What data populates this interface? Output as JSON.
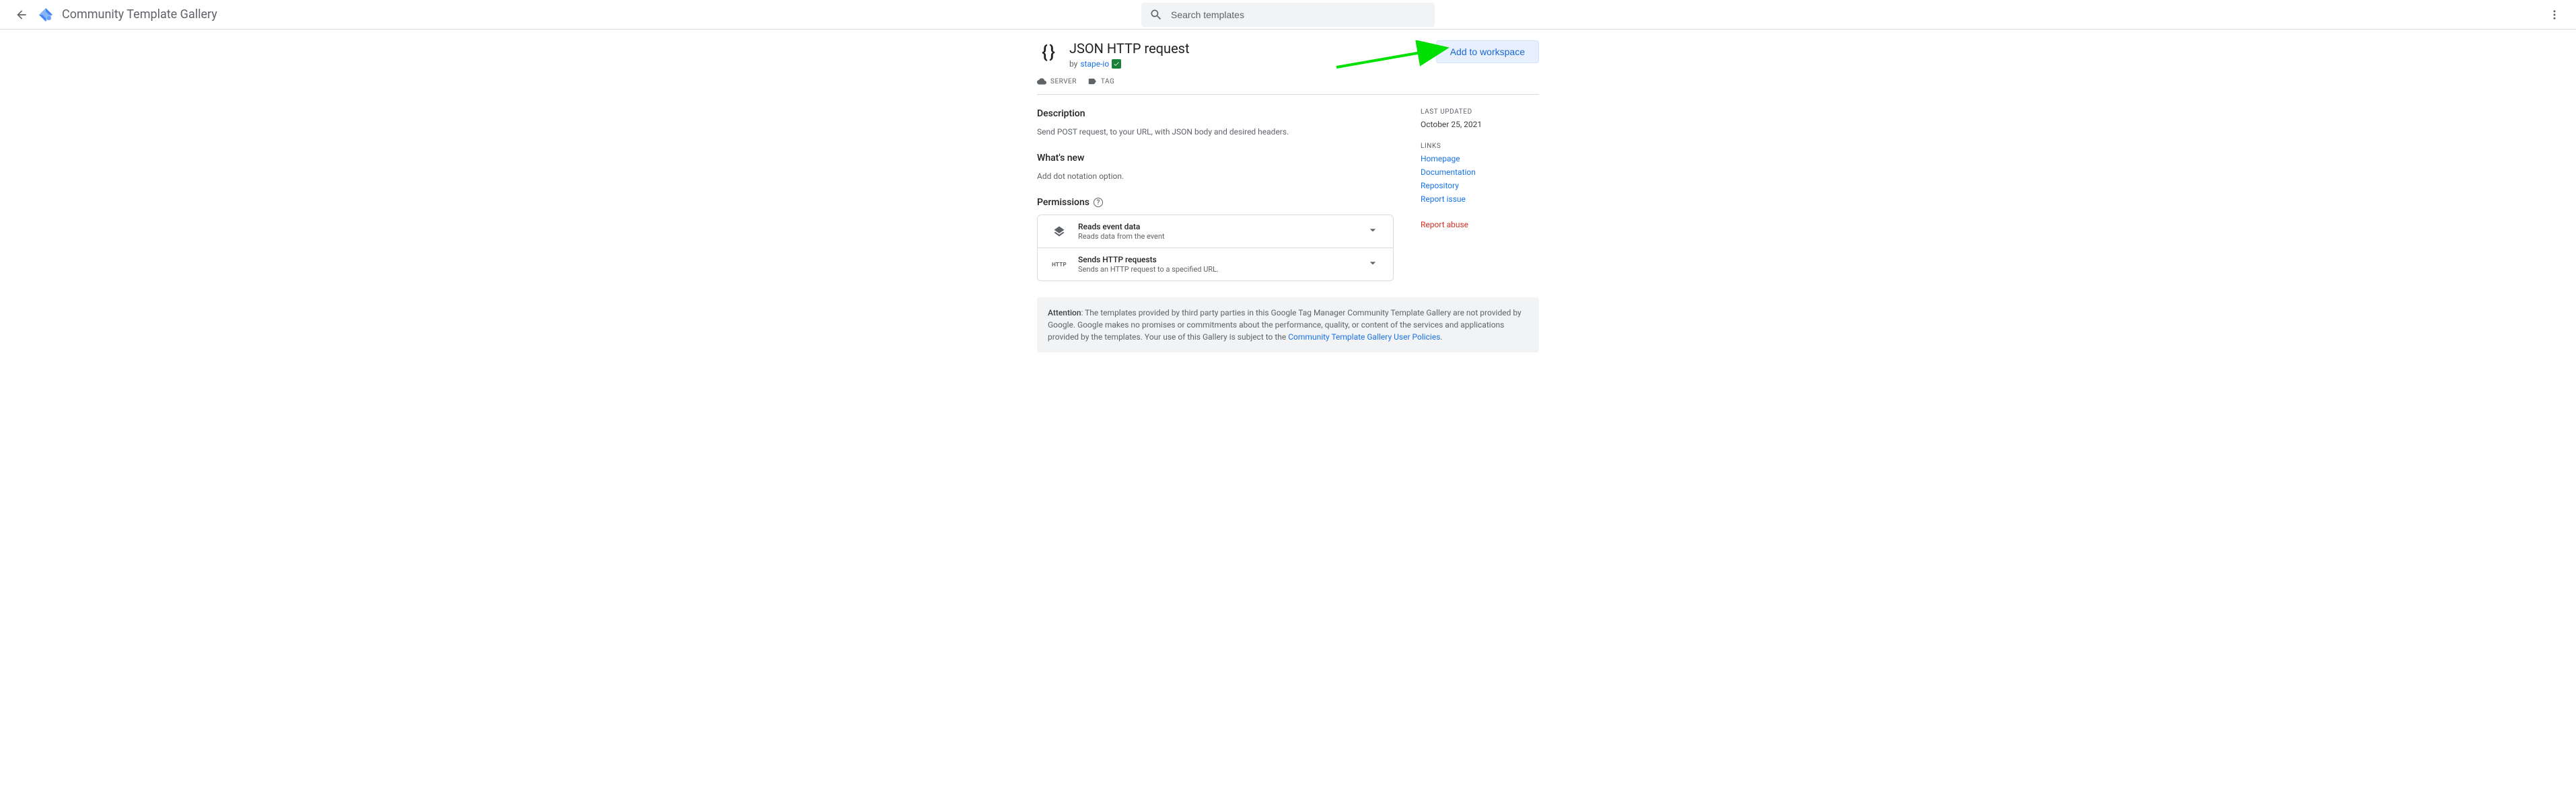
{
  "header": {
    "title": "Community Template Gallery",
    "search_placeholder": "Search templates"
  },
  "template": {
    "icon_glyph": "{ }",
    "title": "JSON HTTP request",
    "by_prefix": "by",
    "author": "stape-io",
    "add_button": "Add to workspace",
    "badge_server": "SERVER",
    "badge_tag": "TAG"
  },
  "sections": {
    "description_h": "Description",
    "description_p": "Send POST request, to your URL, with JSON body and desired headers.",
    "whatsnew_h": "What's new",
    "whatsnew_p": "Add dot notation option.",
    "permissions_h": "Permissions"
  },
  "permissions": [
    {
      "icon": "layers",
      "title": "Reads event data",
      "desc": "Reads data from the event"
    },
    {
      "icon": "http",
      "title": "Sends HTTP requests",
      "desc": "Sends an HTTP request to a specified URL."
    }
  ],
  "sidebar": {
    "last_updated_label": "LAST UPDATED",
    "last_updated_value": "October 25, 2021",
    "links_label": "LINKS",
    "links": {
      "homepage": "Homepage",
      "documentation": "Documentation",
      "repository": "Repository",
      "report_issue": "Report issue"
    },
    "report_abuse": "Report abuse"
  },
  "attention": {
    "label": "Attention",
    "body1": ": The templates provided by third party parties in this Google Tag Manager Community Template Gallery are not provided by Google. Google makes no promises or commitments about the performance, quality, or content of the services and applications provided by the templates. Your use of this Gallery is subject to the ",
    "link": "Community Template Gallery User Policies",
    "body2": "."
  }
}
